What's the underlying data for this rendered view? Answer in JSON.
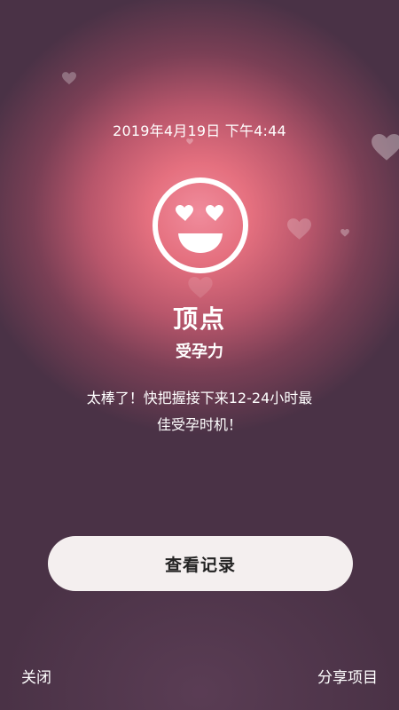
{
  "header": {
    "timestamp": "2019年4月19日 下午4:44"
  },
  "result": {
    "icon": "heart-eyes-smiley-icon",
    "title": "顶点",
    "subtitle": "受孕力",
    "message_line1": "太棒了！快把握接下来12-24小时最",
    "message_line2": "佳受孕时机！"
  },
  "actions": {
    "view_records_label": "查看记录",
    "close_label": "关闭",
    "share_label": "分享项目"
  },
  "colors": {
    "glow_center": "#f08c9c",
    "background_dark": "#3e2f40",
    "button_background": "#f4efef",
    "button_text": "#222222"
  }
}
